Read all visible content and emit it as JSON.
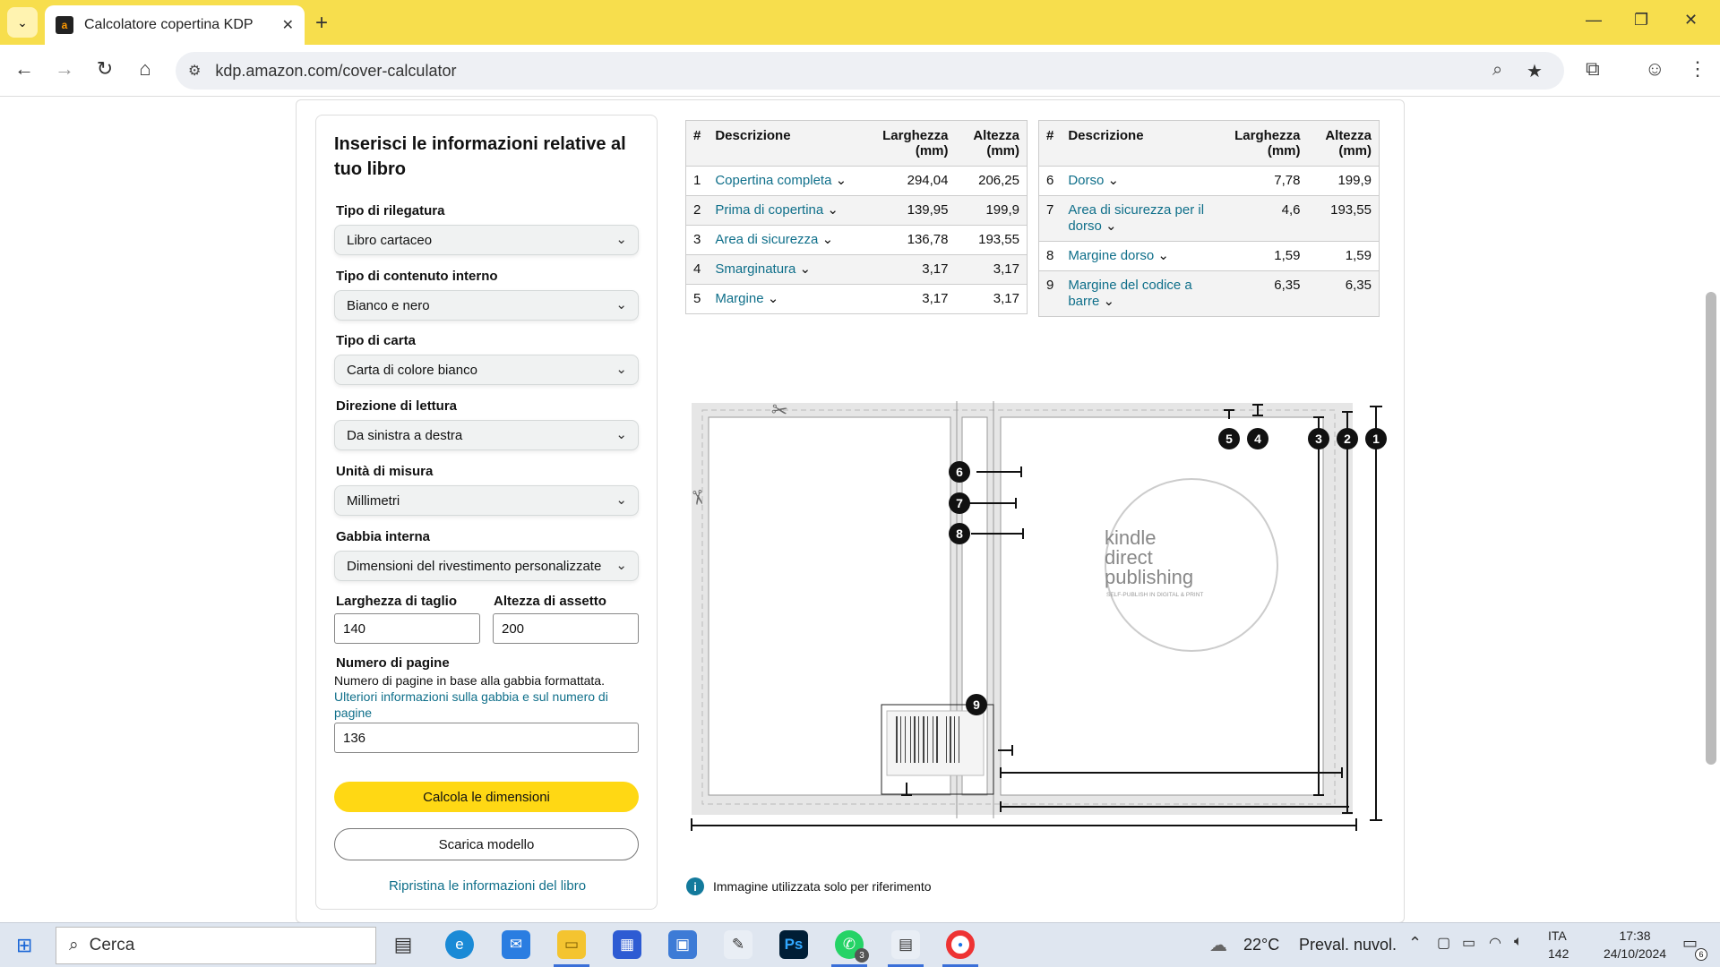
{
  "browser": {
    "tab_title": "Calcolatore copertina KDP",
    "favicon": "a",
    "url": "kdp.amazon.com/cover-calculator"
  },
  "form": {
    "heading": "Inserisci le informazioni relative al tuo libro",
    "binding_label": "Tipo di rilegatura",
    "binding_value": "Libro cartaceo",
    "content_label": "Tipo di contenuto interno",
    "content_value": "Bianco e nero",
    "paper_label": "Tipo di carta",
    "paper_value": "Carta di colore bianco",
    "reading_label": "Direzione di lettura",
    "reading_value": "Da sinistra a destra",
    "unit_label": "Unità di misura",
    "unit_value": "Millimetri",
    "trim_label": "Gabbia interna",
    "trim_value": "Dimensioni del rivestimento personalizzate",
    "width_label": "Larghezza di taglio",
    "width_value": "140",
    "height_label": "Altezza di assetto",
    "height_value": "200",
    "pages_label": "Numero di pagine",
    "pages_help": "Numero di pagine in base alla gabbia formattata.",
    "pages_link": "Ulteriori informazioni sulla gabbia e sul numero di pagine",
    "pages_value": "136",
    "calc_button": "Calcola le dimensioni",
    "download_button": "Scarica modello",
    "reset_link": "Ripristina le informazioni del libro"
  },
  "table_headers": {
    "num": "#",
    "desc": "Descrizione",
    "width": "Larghezza (mm)",
    "height": "Altezza (mm)"
  },
  "table_left": [
    {
      "num": "1",
      "desc": "Copertina completa",
      "width": "294,04",
      "height": "206,25"
    },
    {
      "num": "2",
      "desc": "Prima di copertina",
      "width": "139,95",
      "height": "199,9"
    },
    {
      "num": "3",
      "desc": "Area di sicurezza",
      "width": "136,78",
      "height": "193,55"
    },
    {
      "num": "4",
      "desc": "Smarginatura",
      "width": "3,17",
      "height": "3,17"
    },
    {
      "num": "5",
      "desc": "Margine",
      "width": "3,17",
      "height": "3,17"
    }
  ],
  "table_right": [
    {
      "num": "6",
      "desc": "Dorso",
      "width": "7,78",
      "height": "199,9"
    },
    {
      "num": "7",
      "desc": "Area di sicurezza per il dorso",
      "width": "4,6",
      "height": "193,55"
    },
    {
      "num": "8",
      "desc": "Margine dorso",
      "width": "1,59",
      "height": "1,59"
    },
    {
      "num": "9",
      "desc": "Margine del codice a barre",
      "width": "6,35",
      "height": "6,35"
    }
  ],
  "diagram": {
    "logo_line1": "kindle",
    "logo_line2": "direct",
    "logo_line3": "publishing",
    "logo_tagline": "SELF-PUBLISH IN DIGITAL & PRINT",
    "markers": [
      "1",
      "2",
      "3",
      "4",
      "5",
      "6",
      "7",
      "8",
      "9"
    ],
    "note_icon": "i",
    "note": "Immagine utilizzata solo per riferimento"
  },
  "taskbar": {
    "search_placeholder": "Cerca",
    "weather_temp": "22°C",
    "weather_text": "Preval. nuvol.",
    "lang": "ITA",
    "lang_sub": "142",
    "time": "17:38",
    "date": "24/10/2024",
    "whatsapp_badge": "3",
    "notif_badge": "6"
  },
  "colors": {
    "tabstrip": "#f7de4d",
    "primary_button": "#ffd814",
    "link": "#0f6f8a"
  }
}
